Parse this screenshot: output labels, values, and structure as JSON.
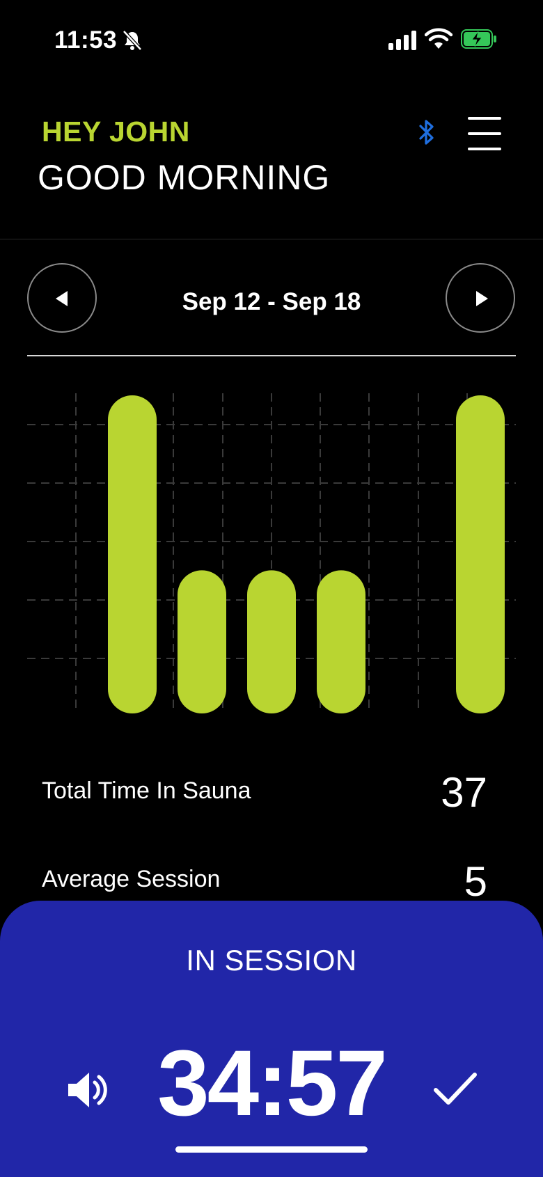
{
  "status_bar": {
    "time": "11:53"
  },
  "header": {
    "greeting": "HEY JOHN",
    "salutation": "GOOD MORNING"
  },
  "week_nav": {
    "range": "Sep 12 - Sep 18"
  },
  "chart_data": {
    "type": "bar",
    "categories": [
      "",
      "",
      "",
      "",
      "",
      "",
      ""
    ],
    "values": [
      100,
      45,
      45,
      45,
      0,
      0,
      100
    ],
    "ylim": [
      0,
      100
    ],
    "grid": true,
    "bar_color": "#b9d531"
  },
  "stats": [
    {
      "label": "Total Time In Sauna",
      "value": "37"
    },
    {
      "label": "Average Session",
      "value": "5"
    }
  ],
  "session": {
    "title": "IN SESSION",
    "timer": "34:57"
  },
  "colors": {
    "accent": "#b9d531",
    "panel": "#2126a8",
    "bluetooth": "#1f6fe0",
    "battery": "#35c759"
  },
  "icons": [
    "bell-off-icon",
    "signal-icon",
    "wifi-icon",
    "battery-icon",
    "bluetooth-icon",
    "menu-icon",
    "arrow-left-icon",
    "arrow-right-icon",
    "speaker-icon",
    "check-icon"
  ]
}
